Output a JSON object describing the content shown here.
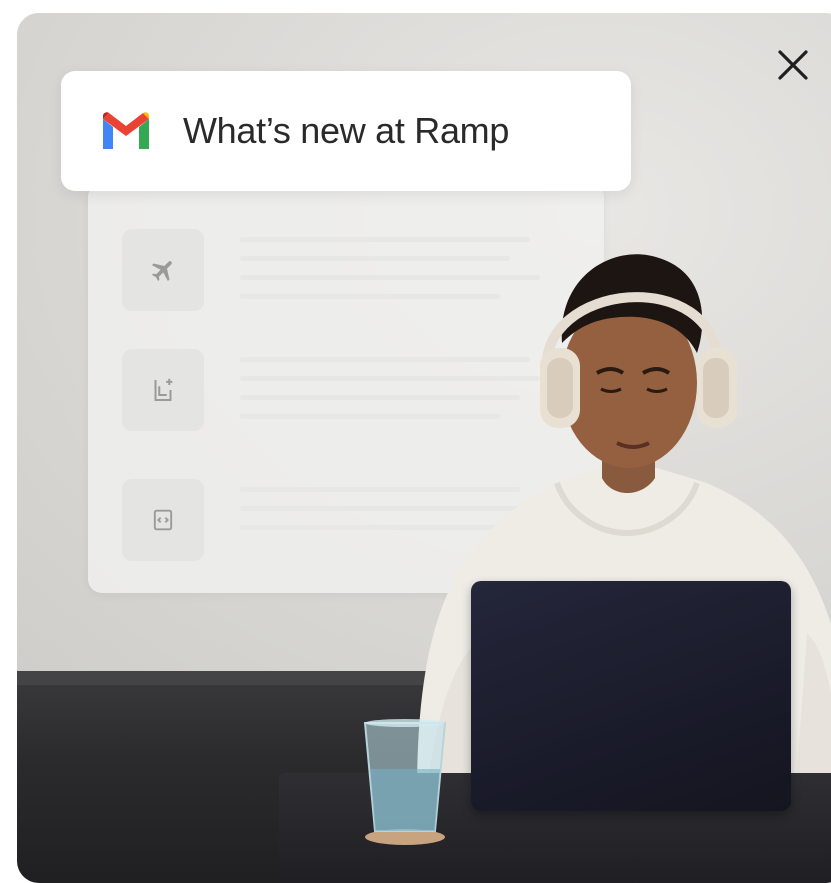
{
  "modal": {
    "header_title": "What’s new at Ramp",
    "close_icon": "close-icon",
    "logo_icon": "gmail-logo-icon"
  },
  "email_panel": {
    "rows": [
      {
        "icon": "airplane-icon"
      },
      {
        "icon": "receipt-add-icon"
      },
      {
        "icon": "code-clipboard-icon"
      }
    ]
  },
  "colors": {
    "gmail_red": "#EA4335",
    "gmail_blue": "#4285F4",
    "gmail_green": "#34A853",
    "gmail_yellow": "#FBBC04"
  }
}
